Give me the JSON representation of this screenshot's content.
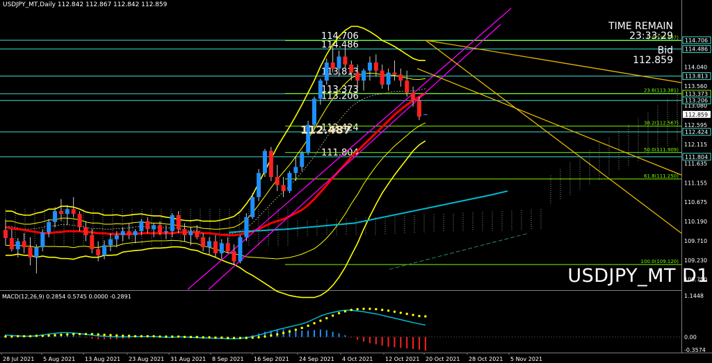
{
  "header": {
    "symbol_label": "USDJPY_MT,Daily",
    "ohlc_text": "112.842 112.867 112.842 112.859"
  },
  "macd_label": "MACD(12,26,9) 0.2854 0.5745 0.0000 -0.2891",
  "chart_title": "USDJPY_MT D1",
  "info": {
    "time_remain_label": "TIME REMAIN",
    "time_remain_value": "23:33:29",
    "bid_label": "Bid",
    "bid_value": "112.859"
  },
  "price_level_labels": [
    {
      "label": "114.706",
      "value": 114.706
    },
    {
      "label": "114.486",
      "value": 114.486
    },
    {
      "label": "113.813",
      "value": 113.813
    },
    {
      "label": "113.373",
      "value": 113.373
    },
    {
      "label": "113.206",
      "value": 113.206
    },
    {
      "label": "112.424",
      "value": 112.424
    },
    {
      "label": "111.804",
      "value": 111.804
    }
  ],
  "current_price_label": {
    "label": "112.487",
    "value": 112.487
  },
  "fibonacci_levels": [
    {
      "label": "0.0(114.697)",
      "value": 114.697
    },
    {
      "label": "23.6(113.381)",
      "value": 113.381
    },
    {
      "label": "38.2(112.567)",
      "value": 112.567
    },
    {
      "label": "50.0(111.909)",
      "value": 111.909
    },
    {
      "label": "61.8(111.250)",
      "value": 111.25
    },
    {
      "label": "100.0(109.120)",
      "value": 109.12
    }
  ],
  "colors": {
    "background": "#000000",
    "bull_candle": "#1e90ff",
    "bear_candle": "#ff2020",
    "level_line": "#40e0d0",
    "fib_line": "#7cfc00",
    "trend_line": "#e6b800",
    "bollinger": "#ffff00",
    "sma_red": "#ff0000",
    "sma_cyan": "#00bcd4",
    "channel": "#ff00ff",
    "macd_line": "#00bcd4",
    "signal_dots": "#ffff00"
  },
  "chart_data": [
    {
      "type": "candlestick",
      "title": "USDJPY_MT D1",
      "ylim": [
        108.5,
        115.5
      ],
      "y_ticks": [
        "114.486",
        "114.040",
        "113.813",
        "113.560",
        "113.373",
        "113.206",
        "113.080",
        "112.859",
        "112.595",
        "112.424",
        "112.115",
        "111.804",
        "111.635",
        "111.155",
        "110.675",
        "110.190",
        "109.710",
        "109.230",
        "108.750"
      ],
      "x_ticks": [
        "28 Jul 2021",
        "5 Aug 2021",
        "13 Aug 2021",
        "23 Aug 2021",
        "31 Aug 2021",
        "8 Sep 2021",
        "16 Sep 2021",
        "24 Sep 2021",
        "4 Oct 2021",
        "12 Oct 2021",
        "20 Oct 2021",
        "28 Oct 2021",
        "5 Nov 2021"
      ],
      "candles": [
        [
          109.98,
          110.25,
          109.6,
          109.78
        ],
        [
          109.78,
          110.0,
          109.45,
          109.5
        ],
        [
          109.5,
          109.78,
          109.3,
          109.7
        ],
        [
          109.7,
          109.9,
          109.4,
          109.55
        ],
        [
          109.55,
          109.8,
          109.1,
          109.3
        ],
        [
          109.3,
          109.62,
          108.9,
          109.55
        ],
        [
          109.55,
          110.0,
          109.45,
          109.92
        ],
        [
          109.92,
          110.25,
          109.8,
          110.18
        ],
        [
          110.18,
          110.55,
          110.05,
          110.45
        ],
        [
          110.45,
          110.75,
          110.2,
          110.38
        ],
        [
          110.38,
          110.6,
          110.1,
          110.5
        ],
        [
          110.5,
          110.8,
          110.3,
          110.38
        ],
        [
          110.38,
          110.45,
          109.95,
          110.05
        ],
        [
          110.05,
          110.2,
          109.7,
          109.85
        ],
        [
          109.85,
          110.0,
          109.4,
          109.5
        ],
        [
          109.5,
          109.7,
          109.2,
          109.35
        ],
        [
          109.35,
          109.72,
          109.25,
          109.6
        ],
        [
          109.6,
          109.9,
          109.45,
          109.75
        ],
        [
          109.75,
          109.95,
          109.55,
          109.85
        ],
        [
          109.85,
          110.05,
          109.7,
          109.95
        ],
        [
          109.95,
          110.15,
          109.75,
          109.85
        ],
        [
          109.85,
          110.0,
          109.65,
          109.95
        ],
        [
          109.95,
          110.25,
          109.85,
          110.2
        ],
        [
          110.2,
          110.3,
          109.9,
          110.0
        ],
        [
          110.0,
          110.15,
          109.8,
          110.1
        ],
        [
          110.1,
          110.2,
          109.85,
          109.92
        ],
        [
          109.92,
          110.1,
          109.75,
          109.95
        ],
        [
          109.95,
          110.4,
          109.8,
          110.35
        ],
        [
          110.35,
          110.45,
          109.9,
          110.0
        ],
        [
          110.0,
          110.15,
          109.7,
          109.85
        ],
        [
          109.85,
          110.05,
          109.6,
          109.95
        ],
        [
          109.95,
          110.1,
          109.75,
          109.8
        ],
        [
          109.8,
          109.9,
          109.45,
          109.55
        ],
        [
          109.55,
          109.8,
          109.35,
          109.7
        ],
        [
          109.7,
          109.85,
          109.3,
          109.4
        ],
        [
          109.4,
          109.75,
          109.25,
          109.65
        ],
        [
          109.65,
          109.8,
          109.4,
          109.45
        ],
        [
          109.45,
          109.62,
          109.11,
          109.2
        ],
        [
          109.2,
          109.85,
          109.15,
          109.8
        ],
        [
          109.8,
          110.4,
          109.7,
          110.3
        ],
        [
          110.3,
          110.9,
          110.25,
          110.8
        ],
        [
          110.8,
          111.5,
          110.7,
          111.4
        ],
        [
          111.4,
          112.0,
          111.3,
          111.95
        ],
        [
          111.95,
          112.05,
          111.2,
          111.3
        ],
        [
          111.3,
          111.6,
          110.95,
          111.1
        ],
        [
          111.1,
          111.3,
          110.8,
          110.95
        ],
        [
          110.95,
          111.45,
          110.9,
          111.4
        ],
        [
          111.4,
          111.8,
          111.2,
          111.55
        ],
        [
          111.55,
          111.95,
          111.45,
          111.9
        ],
        [
          111.9,
          112.7,
          111.85,
          112.6
        ],
        [
          112.6,
          113.3,
          112.5,
          113.25
        ],
        [
          113.25,
          113.75,
          113.1,
          113.7
        ],
        [
          113.7,
          114.25,
          113.6,
          114.15
        ],
        [
          114.15,
          114.55,
          113.9,
          114.0
        ],
        [
          114.0,
          114.45,
          113.8,
          114.3
        ],
        [
          114.3,
          114.7,
          114.0,
          114.1
        ],
        [
          114.1,
          114.2,
          113.7,
          113.9
        ],
        [
          113.9,
          114.1,
          113.5,
          113.7
        ],
        [
          113.7,
          114.0,
          113.45,
          113.95
        ],
        [
          113.95,
          114.3,
          113.7,
          114.15
        ],
        [
          114.15,
          114.35,
          113.8,
          113.95
        ],
        [
          113.95,
          114.1,
          113.5,
          113.6
        ],
        [
          113.6,
          114.0,
          113.45,
          113.9
        ],
        [
          113.9,
          114.2,
          113.7,
          113.85
        ],
        [
          113.85,
          114.0,
          113.55,
          113.7
        ],
        [
          113.7,
          113.95,
          113.3,
          113.4
        ],
        [
          113.4,
          113.55,
          113.05,
          113.2
        ],
        [
          113.2,
          113.3,
          112.72,
          112.8
        ],
        [
          112.842,
          112.867,
          112.842,
          112.859
        ]
      ],
      "bollinger_mid": [
        109.9,
        109.9,
        109.88,
        109.85,
        109.85,
        109.85,
        109.88,
        109.9,
        109.9,
        109.92,
        109.92,
        109.9,
        109.9,
        109.88,
        109.85,
        109.85,
        109.85,
        109.85,
        109.86,
        109.88,
        109.9,
        109.92,
        109.93,
        109.93,
        109.93,
        109.93,
        109.92,
        109.92,
        109.9,
        109.88,
        109.85,
        109.85,
        109.8,
        109.78,
        109.75,
        109.73,
        109.72,
        109.72,
        109.74,
        109.78,
        109.85,
        109.95,
        110.05,
        110.15,
        110.25,
        110.35,
        110.45,
        110.57,
        110.7,
        110.85,
        111.0,
        111.2,
        111.4,
        111.6,
        111.8,
        112.0,
        112.2,
        112.35,
        112.5,
        112.62,
        112.72,
        112.8,
        112.88,
        112.95,
        113.0,
        113.05,
        113.1,
        113.15,
        113.2
      ],
      "bollinger_width": [
        0.55,
        0.55,
        0.5,
        0.5,
        0.5,
        0.55,
        0.55,
        0.6,
        0.6,
        0.65,
        0.65,
        0.65,
        0.6,
        0.55,
        0.55,
        0.55,
        0.5,
        0.5,
        0.5,
        0.45,
        0.45,
        0.45,
        0.45,
        0.42,
        0.4,
        0.4,
        0.38,
        0.36,
        0.34,
        0.34,
        0.36,
        0.38,
        0.4,
        0.42,
        0.45,
        0.5,
        0.55,
        0.6,
        0.7,
        0.85,
        1.0,
        1.2,
        1.4,
        1.6,
        1.8,
        1.95,
        2.1,
        2.25,
        2.4,
        2.55,
        2.7,
        2.85,
        2.95,
        3.0,
        3.0,
        2.95,
        2.85,
        2.7,
        2.5,
        2.3,
        2.1,
        1.9,
        1.75,
        1.6,
        1.45,
        1.3,
        1.15,
        1.05,
        1.0
      ],
      "sma_red": [
        110.05,
        110.02,
        110.0,
        109.98,
        109.95,
        109.93,
        109.9,
        109.9,
        109.92,
        109.93,
        109.95,
        109.95,
        109.95,
        109.93,
        109.92,
        109.9,
        109.9,
        109.88,
        109.88,
        109.88,
        109.88,
        109.88,
        109.9,
        109.9,
        109.9,
        109.9,
        109.9,
        109.9,
        109.92,
        109.92,
        109.92,
        109.92,
        109.9,
        109.9,
        109.88,
        109.86,
        109.85,
        109.85,
        109.87,
        109.9,
        109.95,
        110.0,
        110.08,
        110.15,
        110.2,
        110.25,
        110.32,
        110.4,
        110.48,
        110.6,
        110.75,
        110.92,
        111.1,
        111.28,
        111.45,
        111.62,
        111.8,
        111.95,
        112.1,
        112.25,
        112.4,
        112.55,
        112.7,
        112.85,
        112.98,
        113.1,
        113.2,
        113.3,
        113.38
      ],
      "sma_cyan_x": [
        0.336,
        0.42,
        0.52,
        0.62,
        0.72,
        0.745
      ],
      "sma_cyan": [
        109.92,
        110.0,
        110.15,
        110.5,
        110.85,
        110.95
      ],
      "macd_histogram": [
        0.05,
        0.04,
        0.03,
        0.02,
        0.02,
        0.03,
        0.05,
        0.08,
        0.1,
        0.12,
        0.12,
        0.11,
        0.09,
        0.07,
        0.05,
        0.03,
        0.02,
        0.01,
        0.0,
        0.0,
        0.0,
        0.01,
        0.01,
        0.01,
        0.01,
        0.0,
        -0.01,
        -0.01,
        0.0,
        0.0,
        -0.01,
        -0.02,
        -0.03,
        -0.03,
        -0.04,
        -0.04,
        -0.05,
        -0.05,
        -0.04,
        -0.02,
        0.01,
        0.05,
        0.1,
        0.15,
        0.2,
        0.24,
        0.28,
        0.32,
        0.36,
        0.42,
        0.5,
        0.58,
        0.64,
        0.68,
        0.72,
        0.74,
        0.74,
        0.72,
        0.7,
        0.67,
        0.64,
        0.6,
        0.56,
        0.52,
        0.48,
        0.44,
        0.4,
        0.36,
        0.33
      ],
      "macd_signal": [
        0.01,
        0.01,
        0.02,
        0.02,
        0.02,
        0.03,
        0.03,
        0.04,
        0.05,
        0.06,
        0.07,
        0.08,
        0.08,
        0.08,
        0.08,
        0.07,
        0.06,
        0.05,
        0.04,
        0.03,
        0.03,
        0.02,
        0.02,
        0.02,
        0.02,
        0.01,
        0.01,
        0.01,
        0.01,
        0.0,
        0.0,
        0.0,
        -0.01,
        -0.01,
        -0.02,
        -0.02,
        -0.03,
        -0.03,
        -0.03,
        -0.03,
        -0.02,
        -0.01,
        0.01,
        0.04,
        0.07,
        0.11,
        0.15,
        0.2,
        0.25,
        0.31,
        0.38,
        0.45,
        0.52,
        0.59,
        0.66,
        0.71,
        0.75,
        0.77,
        0.78,
        0.78,
        0.77,
        0.75,
        0.73,
        0.7,
        0.67,
        0.64,
        0.61,
        0.58,
        0.57
      ],
      "macd_ylim": [
        -0.3574,
        1.1448
      ],
      "macd_ticks": [
        "1.1448",
        "0.00",
        "-0.3574"
      ]
    }
  ]
}
